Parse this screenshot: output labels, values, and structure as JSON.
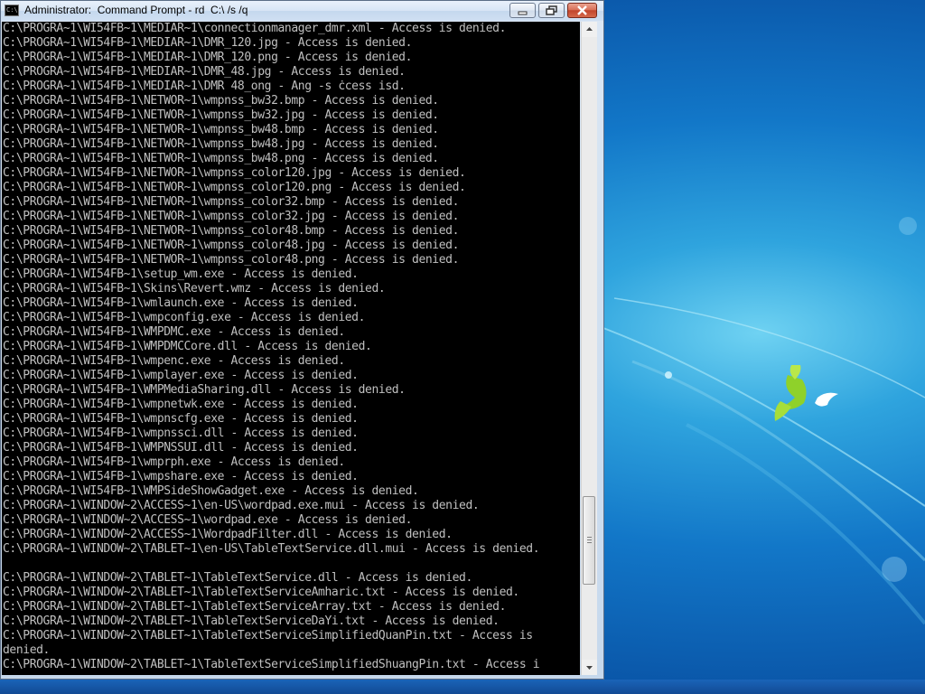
{
  "window": {
    "title": "Administrator:  Command Prompt - rd  C:\\ /s /q",
    "icon_text": "C:\\"
  },
  "console": {
    "lines": [
      "C:\\PROGRA~1\\WI54FB~1\\MEDIAR~1\\connectionmanager_dmr.xml - Access is denied.",
      "C:\\PROGRA~1\\WI54FB~1\\MEDIAR~1\\DMR_120.jpg - Access is denied.",
      "C:\\PROGRA~1\\WI54FB~1\\MEDIAR~1\\DMR_120.png - Access is denied.",
      "C:\\PROGRA~1\\WI54FB~1\\MEDIAR~1\\DMR_48.jpg - Access is denied.",
      "C:\\PROGRA~1\\WI54FB~1\\MEDIAR~1\\DMR 48_ong - Ang -s ċcess isd.",
      "C:\\PROGRA~1\\WI54FB~1\\NETWOR~1\\wmpnss_bw32.bmp - Access is denied.",
      "C:\\PROGRA~1\\WI54FB~1\\NETWOR~1\\wmpnss_bw32.jpg - Access is denied.",
      "C:\\PROGRA~1\\WI54FB~1\\NETWOR~1\\wmpnss_bw48.bmp - Access is denied.",
      "C:\\PROGRA~1\\WI54FB~1\\NETWOR~1\\wmpnss_bw48.jpg - Access is denied.",
      "C:\\PROGRA~1\\WI54FB~1\\NETWOR~1\\wmpnss_bw48.png - Access is denied.",
      "C:\\PROGRA~1\\WI54FB~1\\NETWOR~1\\wmpnss_color120.jpg - Access is denied.",
      "C:\\PROGRA~1\\WI54FB~1\\NETWOR~1\\wmpnss_color120.png - Access is denied.",
      "C:\\PROGRA~1\\WI54FB~1\\NETWOR~1\\wmpnss_color32.bmp - Access is denied.",
      "C:\\PROGRA~1\\WI54FB~1\\NETWOR~1\\wmpnss_color32.jpg - Access is denied.",
      "C:\\PROGRA~1\\WI54FB~1\\NETWOR~1\\wmpnss_color48.bmp - Access is denied.",
      "C:\\PROGRA~1\\WI54FB~1\\NETWOR~1\\wmpnss_color48.jpg - Access is denied.",
      "C:\\PROGRA~1\\WI54FB~1\\NETWOR~1\\wmpnss_color48.png - Access is denied.",
      "C:\\PROGRA~1\\WI54FB~1\\setup_wm.exe - Access is denied.",
      "C:\\PROGRA~1\\WI54FB~1\\Skins\\Revert.wmz - Access is denied.",
      "C:\\PROGRA~1\\WI54FB~1\\wmlaunch.exe - Access is denied.",
      "C:\\PROGRA~1\\WI54FB~1\\wmpconfig.exe - Access is denied.",
      "C:\\PROGRA~1\\WI54FB~1\\WMPDMC.exe - Access is denied.",
      "C:\\PROGRA~1\\WI54FB~1\\WMPDMCCore.dll - Access is denied.",
      "C:\\PROGRA~1\\WI54FB~1\\wmpenc.exe - Access is denied.",
      "C:\\PROGRA~1\\WI54FB~1\\wmplayer.exe - Access is denied.",
      "C:\\PROGRA~1\\WI54FB~1\\WMPMediaSharing.dll - Access is denied.",
      "C:\\PROGRA~1\\WI54FB~1\\wmpnetwk.exe - Access is denied.",
      "C:\\PROGRA~1\\WI54FB~1\\wmpnscfg.exe - Access is denied.",
      "C:\\PROGRA~1\\WI54FB~1\\wmpnssci.dll - Access is denied.",
      "C:\\PROGRA~1\\WI54FB~1\\WMPNSSUI.dll - Access is denied.",
      "C:\\PROGRA~1\\WI54FB~1\\wmprph.exe - Access is denied.",
      "C:\\PROGRA~1\\WI54FB~1\\wmpshare.exe - Access is denied.",
      "C:\\PROGRA~1\\WI54FB~1\\WMPSideShowGadget.exe - Access is denied.",
      "C:\\PROGRA~1\\WINDOW~2\\ACCESS~1\\en-US\\wordpad.exe.mui - Access is denied.",
      "C:\\PROGRA~1\\WINDOW~2\\ACCESS~1\\wordpad.exe - Access is denied.",
      "C:\\PROGRA~1\\WINDOW~2\\ACCESS~1\\WordpadFilter.dll - Access is denied.",
      "C:\\PROGRA~1\\WINDOW~2\\TABLET~1\\en-US\\TableTextService.dll.mui - Access is denied.",
      "",
      "C:\\PROGRA~1\\WINDOW~2\\TABLET~1\\TableTextService.dll - Access is denied.",
      "C:\\PROGRA~1\\WINDOW~2\\TABLET~1\\TableTextServiceAmharic.txt - Access is denied.",
      "C:\\PROGRA~1\\WINDOW~2\\TABLET~1\\TableTextServiceArray.txt - Access is denied.",
      "C:\\PROGRA~1\\WINDOW~2\\TABLET~1\\TableTextServiceDaYi.txt - Access is denied.",
      "C:\\PROGRA~1\\WINDOW~2\\TABLET~1\\TableTextServiceSimplifiedQuanPin.txt - Access is",
      "denied.",
      "C:\\PROGRA~1\\WINDOW~2\\TABLET~1\\TableTextServiceSimplifiedShuangPin.txt - Access i"
    ]
  },
  "scrollbar": {
    "position_fraction": 0.86
  }
}
